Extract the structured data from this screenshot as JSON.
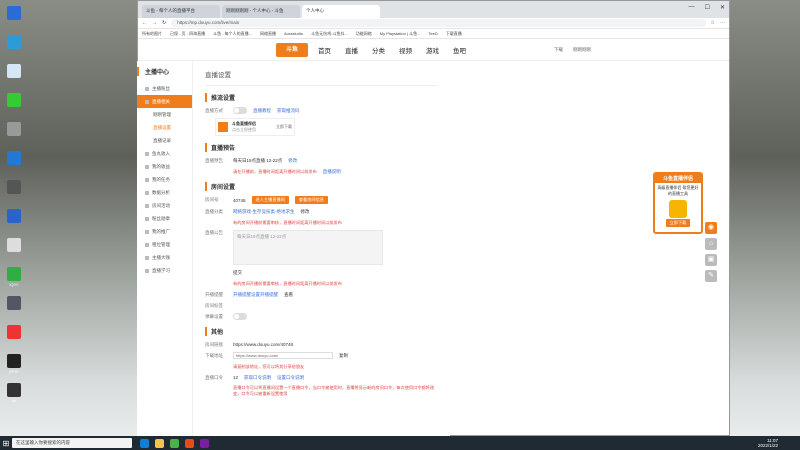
{
  "desktop_icons": [
    {
      "label": "",
      "color": "#2a6bd6"
    },
    {
      "label": "",
      "color": "#2d9bd8"
    },
    {
      "label": "",
      "color": "#d5e6f6"
    },
    {
      "label": "",
      "color": "#3c3"
    },
    {
      "label": "",
      "color": "#999"
    },
    {
      "label": "",
      "color": "#2478d4"
    },
    {
      "label": "",
      "color": "#555"
    },
    {
      "label": "",
      "color": "#2b63c6"
    },
    {
      "label": "",
      "color": "#ddd"
    },
    {
      "label": "iQIYI",
      "color": "#2fae43"
    },
    {
      "label": "",
      "color": "#556"
    },
    {
      "label": "",
      "color": "#e33"
    },
    {
      "label": "EPIC",
      "color": "#222"
    },
    {
      "label": "yu",
      "color": "#333"
    }
  ],
  "browser": {
    "tabs": [
      "斗鱼 - 每个人的直播平台",
      "刚刚刚刚刚 - 个人中心 - 斗鱼",
      "个人中心"
    ],
    "url": "https://mp.douyu.com/live/main",
    "bookmarks": [
      "所有的图片",
      "已保 - 页 - 四海直播",
      "斗鱼 - 每个人的直播...",
      "网络直播",
      "Aurastudio",
      "斗鱼无伤鸡-斗鱼抖...",
      "功能网络",
      "My Playstation | 斗鱼...",
      "TeeD",
      "下载直播"
    ]
  },
  "topnav": {
    "logo": "斗鱼",
    "items": [
      "首页",
      "直播",
      "分类",
      "视频",
      "游戏",
      "鱼吧"
    ],
    "right": [
      "下载",
      "刚刚刚刚"
    ]
  },
  "sidebar": {
    "title": "主播中心",
    "items": [
      {
        "label": "主播粉丝",
        "active": false,
        "sub": false
      },
      {
        "label": "直播相关",
        "active": true,
        "sub": false
      },
      {
        "label": "刚刚管理",
        "active": false,
        "sub": true
      },
      {
        "label": "直播设置",
        "active": false,
        "sub": true,
        "on": true
      },
      {
        "label": "直播记录",
        "active": false,
        "sub": true
      },
      {
        "label": "鱼丸收入",
        "active": false,
        "sub": false
      },
      {
        "label": "我的收益",
        "active": false,
        "sub": false
      },
      {
        "label": "我的任务",
        "active": false,
        "sub": false
      },
      {
        "label": "数据分析",
        "active": false,
        "sub": false
      },
      {
        "label": "房间活动",
        "active": false,
        "sub": false
      },
      {
        "label": "粉丝勋章",
        "active": false,
        "sub": false
      },
      {
        "label": "我的推广",
        "active": false,
        "sub": false
      },
      {
        "label": "租位管理",
        "active": false,
        "sub": false
      },
      {
        "label": "主播大咖",
        "active": false,
        "sub": false
      },
      {
        "label": "直播学习",
        "active": false,
        "sub": false
      }
    ]
  },
  "content": {
    "page_title": "直播设置",
    "push": {
      "title": "推流设置",
      "label": "直播方式",
      "link1": "直播教程",
      "link2": "获取推流码",
      "card_title": "斗鱼直播伴侣",
      "card_sub": "点击立即使用",
      "card_btn": "立即下载"
    },
    "preview": {
      "title": "直播预告",
      "label": "直播预告",
      "value": "每天日19点直播 12-22点",
      "edit": "修改",
      "warn": "请在开播前，直播时间距离开播时间以前发布",
      "link": "直播说明"
    },
    "room": {
      "title": "房间设置",
      "id_label": "房间号",
      "id_value": "40748",
      "btn1": "进入主播直播间",
      "btn2": "查看房间信息",
      "cat_label": "直播分类",
      "cat_value": "网络游戏-生存竞技类-绝地求生",
      "cat_edit": "修改",
      "warn1": "有的房间开播前需要审核，直播时间距离开播时间以前发布",
      "intro_label": "直播公告",
      "intro_value": "每天日19点直播 12-22点",
      "submit": "提交",
      "warn2": "有的房间开播前需要审核，直播时间距离开播时间以前发布",
      "notice_label": "开播提醒",
      "notice_link": "开播提醒设置开播提醒",
      "notice_btn": "查看",
      "tag_label": "房间标签",
      "tv_label": "弹幕设置"
    },
    "other": {
      "title": "其他",
      "link_label": "房间链接",
      "link_value": "https://www.douyu.com/40748",
      "share_label": "下载地址",
      "share_value": "https://www.douyu.com/",
      "share_btn": "复制",
      "share_warn": "请复制该地址，您可以将其分享给朋友",
      "age_label": "直播口令",
      "age_value": "12",
      "age_link1": "获取口令说明",
      "age_link2": "设置口令说明",
      "age_warn": "直播口令可以将直播间设置一个直播口令，当口令被使用时，直播将显示新的房间口令，每次使用口令都将改变，口令可以被重新设置使用"
    }
  },
  "promo": {
    "head": "斗鱼直播伴侣",
    "body": "高级直播伴侣 帮您更好的直播工具",
    "btn": "立即下载"
  },
  "taskbar": {
    "search": "在这里输入你要搜索的内容",
    "time": "11:07",
    "date": "2022/1/22"
  }
}
